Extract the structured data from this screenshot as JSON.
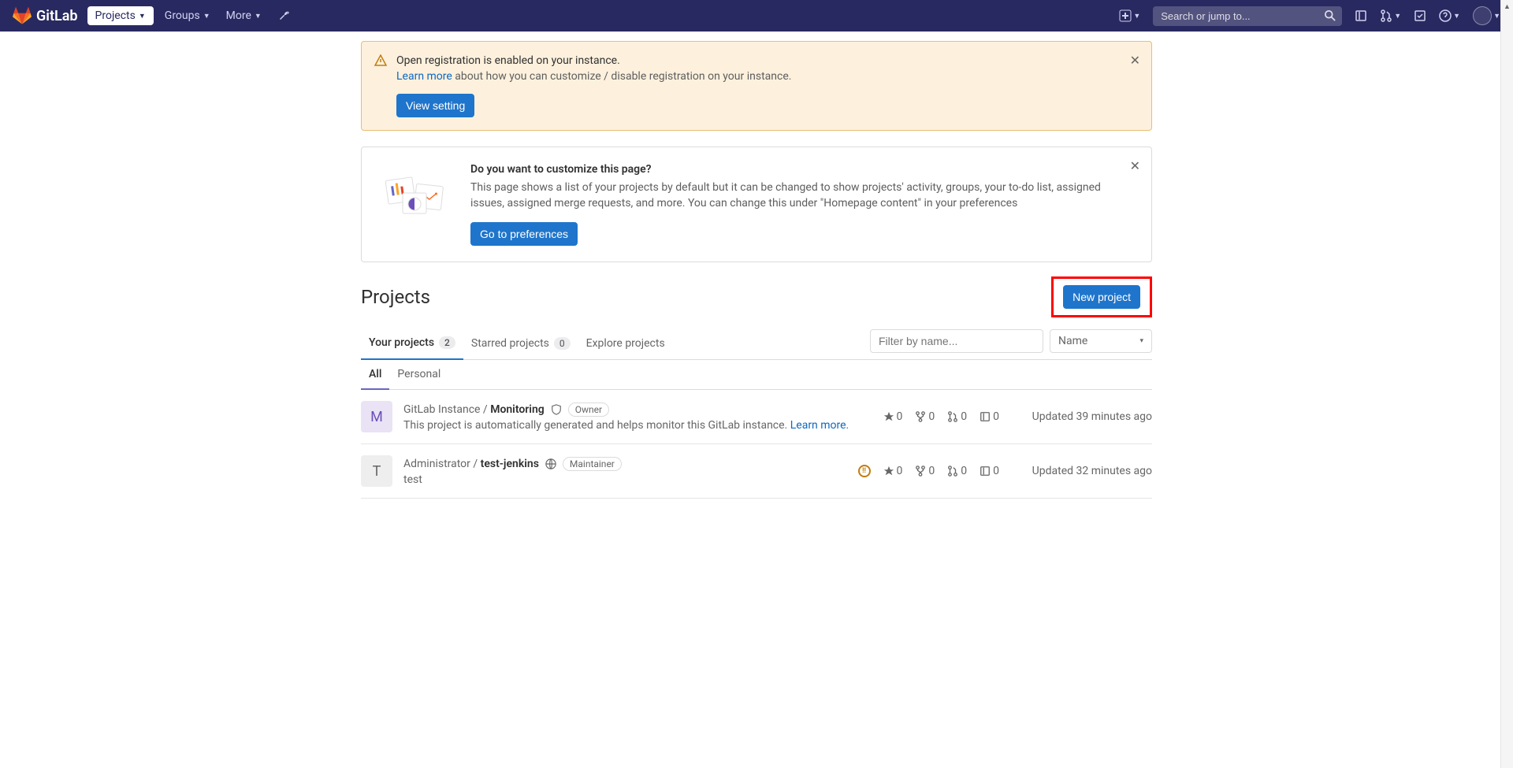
{
  "navbar": {
    "brand": "GitLab",
    "projects": "Projects",
    "groups": "Groups",
    "more": "More",
    "search_placeholder": "Search or jump to..."
  },
  "alert": {
    "title": "Open registration is enabled on your instance.",
    "learn_more": "Learn more",
    "desc_rest": " about how you can customize / disable registration on your instance.",
    "button": "View setting"
  },
  "customize": {
    "title": "Do you want to customize this page?",
    "desc": "This page shows a list of your projects by default but it can be changed to show projects' activity, groups, your to-do list, assigned issues, assigned merge requests, and more. You can change this under \"Homepage content\" in your preferences",
    "button": "Go to preferences"
  },
  "page": {
    "title": "Projects",
    "new_project": "New project"
  },
  "tabs": {
    "your": "Your projects",
    "your_count": "2",
    "starred": "Starred projects",
    "starred_count": "0",
    "explore": "Explore projects",
    "filter_placeholder": "Filter by name...",
    "sort_label": "Name"
  },
  "sub_tabs": {
    "all": "All",
    "personal": "Personal"
  },
  "projects": [
    {
      "avatar_letter": "M",
      "avatar_class": "m",
      "path": "GitLab Instance / ",
      "name": "Monitoring",
      "visibility": "internal",
      "role": "Owner",
      "desc": "This project is automatically generated and helps monitor this GitLab instance. ",
      "desc_link": "Learn more.",
      "pipeline": false,
      "stars": "0",
      "forks": "0",
      "mrs": "0",
      "issues": "0",
      "updated": "Updated 39 minutes ago"
    },
    {
      "avatar_letter": "T",
      "avatar_class": "t",
      "path": "Administrator / ",
      "name": "test-jenkins",
      "visibility": "public",
      "role": "Maintainer",
      "desc": "test",
      "desc_link": "",
      "pipeline": true,
      "stars": "0",
      "forks": "0",
      "mrs": "0",
      "issues": "0",
      "updated": "Updated 32 minutes ago"
    }
  ]
}
